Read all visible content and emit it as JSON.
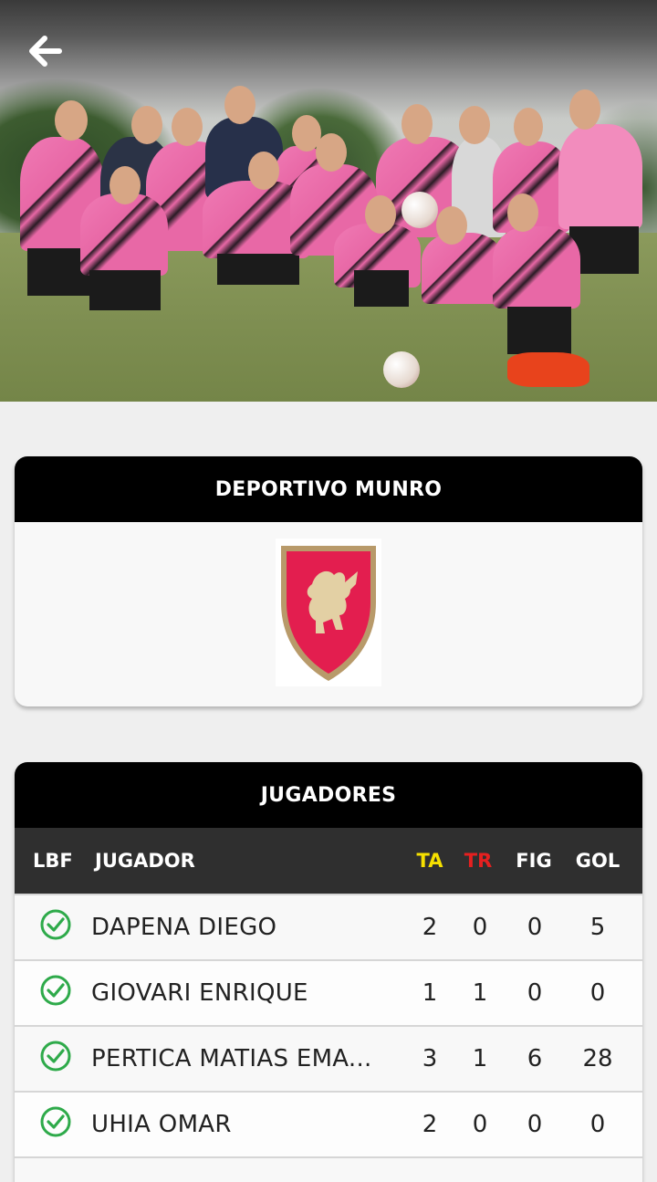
{
  "header": {
    "back_icon": "arrow-left-icon"
  },
  "team": {
    "name": "DEPORTIVO MUNRO",
    "crest_colors": {
      "field": "#e31e4f",
      "lion": "#e3d0a4",
      "border": "#b89a6a"
    }
  },
  "players_section": {
    "title": "JUGADORES",
    "columns": {
      "lbf": "LBF",
      "player": "JUGADOR",
      "ta": "TA",
      "tr": "TR",
      "fig": "FIG",
      "gol": "GOL"
    },
    "column_colors": {
      "ta": "#f6e000",
      "tr": "#e52020"
    },
    "rows": [
      {
        "name": "DAPENA DIEGO",
        "ta": "2",
        "tr": "0",
        "fig": "0",
        "gol": "5",
        "lbf_icon": "check-circle-icon"
      },
      {
        "name": "GIOVARI ENRIQUE",
        "ta": "1",
        "tr": "1",
        "fig": "0",
        "gol": "0",
        "lbf_icon": "check-circle-icon"
      },
      {
        "name": "PERTICA MATIAS EMA...",
        "ta": "3",
        "tr": "1",
        "fig": "6",
        "gol": "28",
        "lbf_icon": "check-circle-icon"
      },
      {
        "name": "UHIA OMAR",
        "ta": "2",
        "tr": "0",
        "fig": "0",
        "gol": "0",
        "lbf_icon": "check-circle-icon"
      }
    ]
  },
  "colors": {
    "check": "#2eaa4a",
    "header_bg": "#000000",
    "table_head_bg": "#2f2f2f"
  }
}
